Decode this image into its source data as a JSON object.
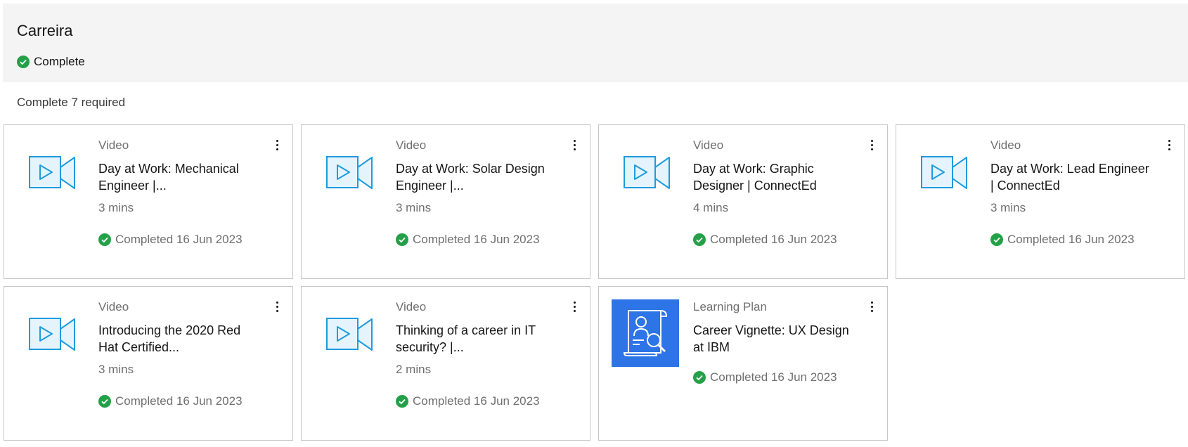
{
  "section": {
    "title": "Carreira",
    "status": "Complete",
    "required_text": "Complete 7 required"
  },
  "colors": {
    "check": "#24a148",
    "video_icon": "#1f9bde",
    "plan_thumb": "#2d74e6"
  },
  "cards": [
    {
      "type": "Video",
      "title": "Day at Work: Mechanical Engineer |...",
      "duration": "3 mins",
      "completed": "Completed 16 Jun 2023",
      "icon": "video-camera-icon"
    },
    {
      "type": "Video",
      "title": "Day at Work: Solar Design Engineer |...",
      "duration": "3 mins",
      "completed": "Completed 16 Jun 2023",
      "icon": "video-camera-icon"
    },
    {
      "type": "Video",
      "title": "Day at Work: Graphic Designer | ConnectEd",
      "duration": "4 mins",
      "completed": "Completed 16 Jun 2023",
      "icon": "video-camera-icon"
    },
    {
      "type": "Video",
      "title": "Day at Work: Lead Engineer | ConnectEd",
      "duration": "3 mins",
      "completed": "Completed 16 Jun 2023",
      "icon": "video-camera-icon"
    },
    {
      "type": "Video",
      "title": "Introducing the 2020 Red Hat Certified...",
      "duration": "3 mins",
      "completed": "Completed 16 Jun 2023",
      "icon": "video-camera-icon"
    },
    {
      "type": "Video",
      "title": "Thinking of a career in IT security? |...",
      "duration": "2 mins",
      "completed": "Completed 16 Jun 2023",
      "icon": "video-camera-icon"
    },
    {
      "type": "Learning Plan",
      "title": "Career Vignette: UX Design at IBM",
      "completed": "Completed 16 Jun 2023",
      "icon": "learning-plan-icon"
    }
  ]
}
